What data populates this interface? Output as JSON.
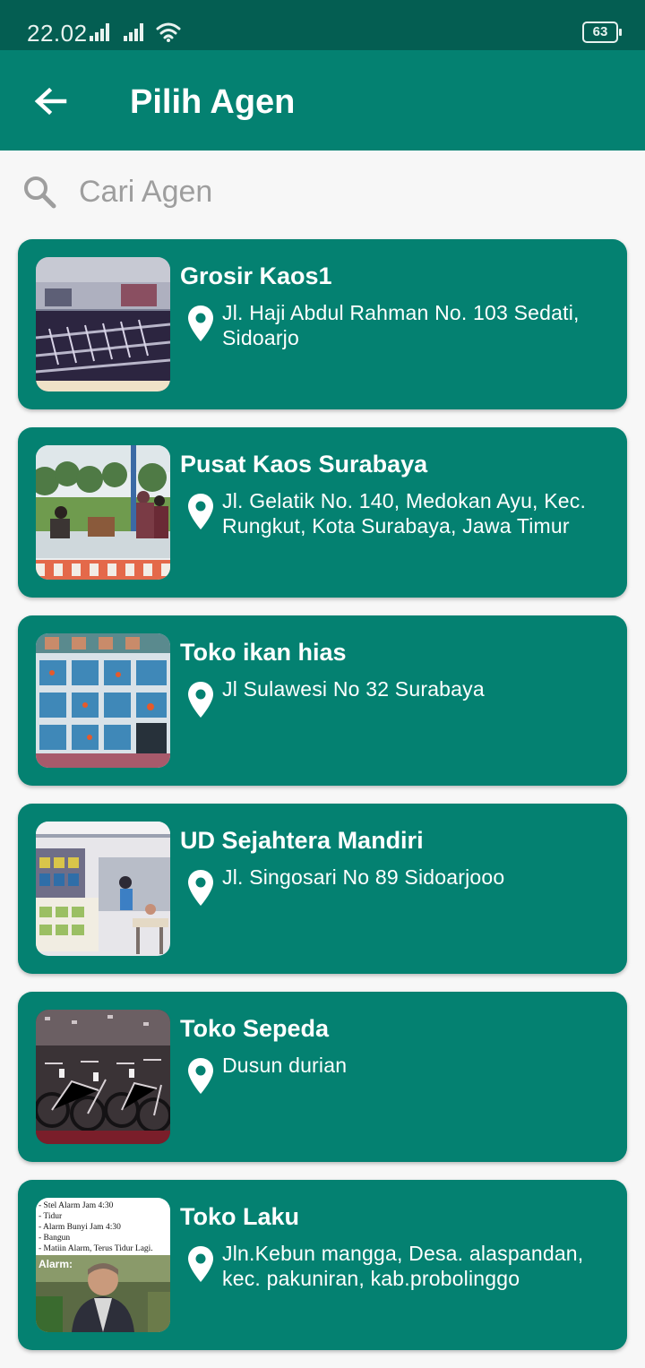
{
  "status_bar": {
    "time": "22.02",
    "battery": "63"
  },
  "app_bar": {
    "title": "Pilih Agen",
    "back_icon": "arrow-left-icon"
  },
  "search": {
    "placeholder": "Cari Agen",
    "value": "",
    "icon": "search-icon"
  },
  "agents": [
    {
      "name": "Grosir Kaos1",
      "address": "Jl. Haji Abdul Rahman No. 103 Sedati, Sidoarjo"
    },
    {
      "name": "Pusat Kaos Surabaya",
      "address": "Jl. Gelatik No. 140, Medokan Ayu, Kec. Rungkut, Kota Surabaya, Jawa Timur"
    },
    {
      "name": "Toko ikan hias",
      "address": "Jl Sulawesi No 32 Surabaya"
    },
    {
      "name": "UD Sejahtera Mandiri",
      "address": "Jl. Singosari No 89 Sidoarjooo"
    },
    {
      "name": "Toko Sepeda",
      "address": "Dusun durian"
    },
    {
      "name": "Toko Laku",
      "address": "Jln.Kebun mangga, Desa. alaspandan, kec. pakuniran, kab.probolinggo",
      "thumbnail_text": {
        "lines": [
          "- Stel Alarm Jam 4:30",
          "- Tidur",
          "- Alarm Bunyi Jam 4:30",
          "- Bangun",
          "- Matiin Alarm, Terus Tidur Lagi."
        ],
        "caption": "Alarm:"
      }
    }
  ],
  "colors": {
    "status_bar": "#045e52",
    "primary": "#048171",
    "background": "#f7f7f7",
    "on_primary": "#ffffff",
    "placeholder": "#9e9e9e"
  }
}
